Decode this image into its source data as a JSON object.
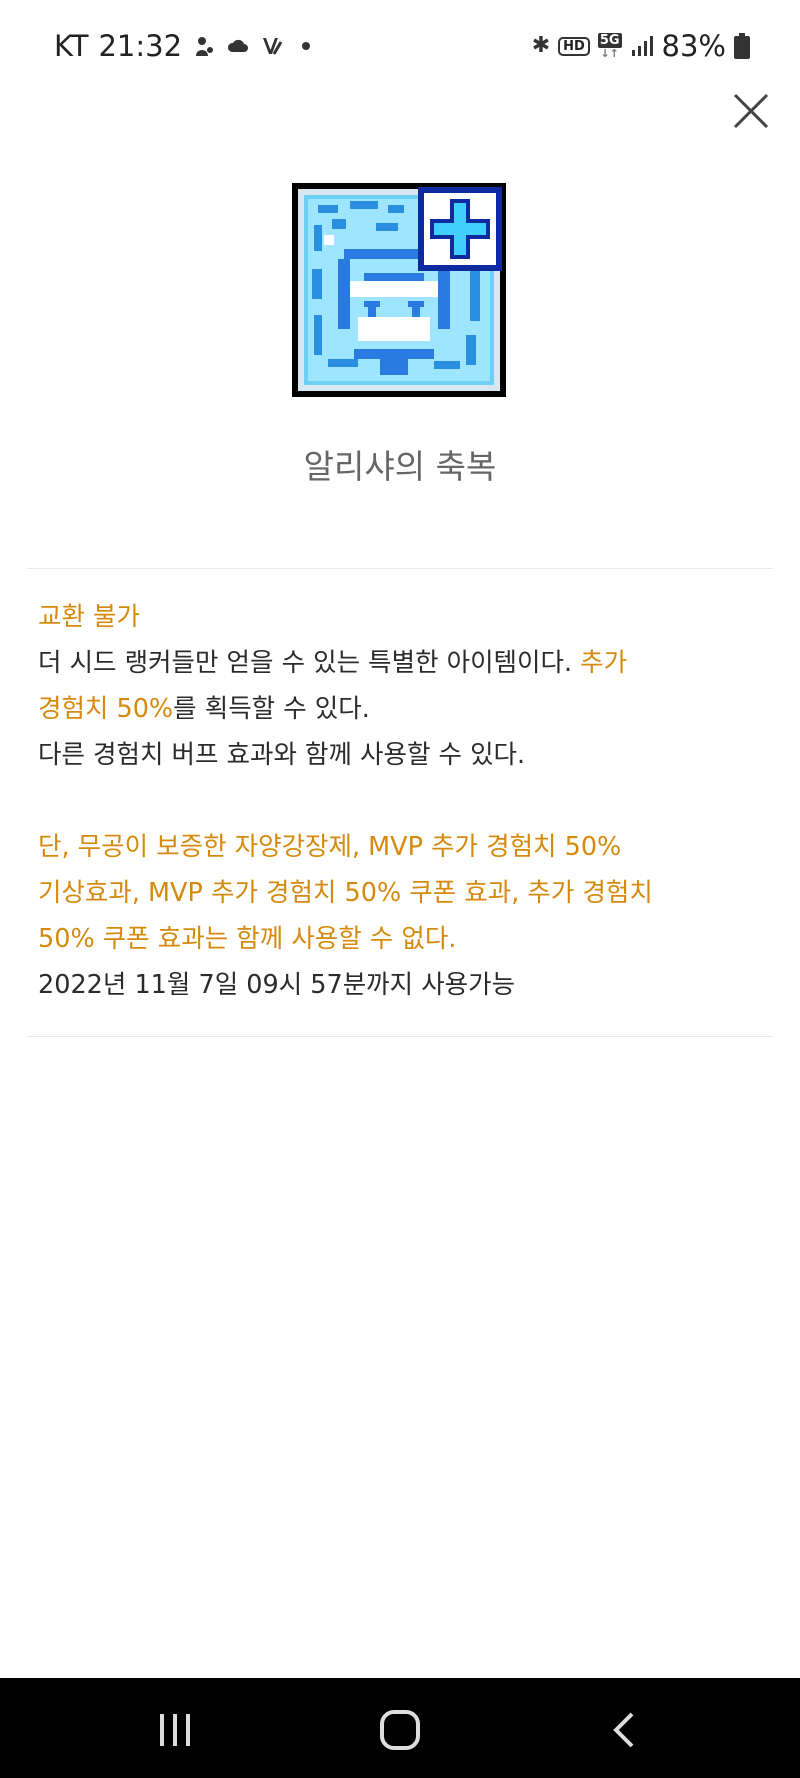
{
  "status_bar": {
    "carrier": "KT",
    "time": "21:32",
    "battery": "83%",
    "left_icons": [
      "notification-icon",
      "cloud-icon",
      "v-app-icon",
      "dot-icon"
    ],
    "right_icons": [
      "bluetooth-icon",
      "hd-icon",
      "5g-icon",
      "signal-icon",
      "battery-icon"
    ],
    "hd_label": "HD",
    "network_label": "5G"
  },
  "item": {
    "name": "알리샤의 축복",
    "icon": "alisha-blessing-icon"
  },
  "description": {
    "line1": "교환 불가",
    "line2_a": "더 시드 랭커들만 얻을 수 있는 특별한 아이템이다. ",
    "line2_b": "추가",
    "line3_a": "경험치 50%",
    "line3_b": "를 획득할 수 있다.",
    "line4": "다른 경험치 버프 효과와 함께 사용할 수 있다.",
    "line5": "단, 무공이 보증한 자양강장제, MVP 추가 경험치 50%",
    "line6": "기상효과, MVP 추가 경험치 50% 쿠폰 효과, 추가 경험치",
    "line7": "50% 쿠폰 효과는 함께 사용할 수 없다.",
    "line8": "2022년 11월 7일 09시 57분까지 사용가능"
  },
  "colors": {
    "highlight": "#d58a0e",
    "text": "#2b2b2b",
    "item_name": "#666666"
  },
  "nav_bar": {
    "buttons": [
      "recent-apps-icon",
      "home-icon",
      "back-icon"
    ]
  }
}
